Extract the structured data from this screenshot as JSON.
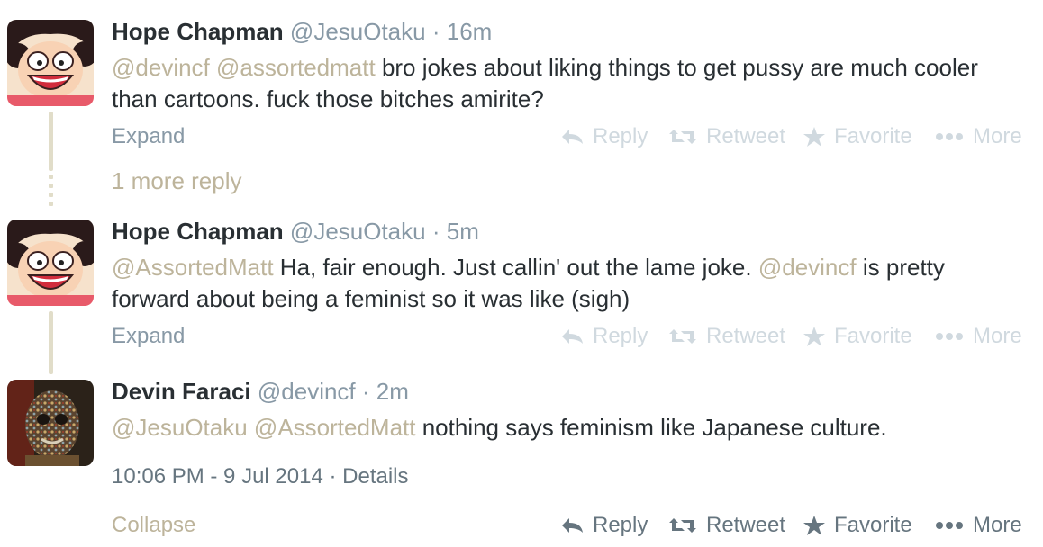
{
  "tweets": [
    {
      "name": "Hope Chapman",
      "handle": "@JesuOtaku",
      "sep": "·",
      "time": "16m",
      "mentions": [
        "@devincf",
        "@assortedmatt"
      ],
      "text": "bro jokes about liking things to get pussy are much cooler than cartoons. fuck those bitches amirite?",
      "expand_label": "Expand"
    },
    {
      "name": "Hope Chapman",
      "handle": "@JesuOtaku",
      "sep": "·",
      "time": "5m",
      "mention1": "@AssortedMatt",
      "text_part1": "Ha, fair enough. Just callin' out the lame joke.",
      "mention2": "@devincf",
      "text_part2": "is pretty forward about being a feminist so it was like (sigh)",
      "expand_label": "Expand"
    },
    {
      "name": "Devin Faraci",
      "handle": "@devincf",
      "sep": "·",
      "time": "2m",
      "mentions": [
        "@JesuOtaku",
        "@AssortedMatt"
      ],
      "text": "nothing says feminism like Japanese culture.",
      "collapse_label": "Collapse"
    }
  ],
  "more_replies": "1 more reply",
  "details": {
    "timestamp": "10:06 PM - 9 Jul 2014",
    "sep": "·",
    "link": "Details"
  },
  "actions": {
    "reply": "Reply",
    "retweet": "Retweet",
    "favorite": "Favorite",
    "more": "More"
  },
  "icons": {
    "reply": "reply-arrow-icon",
    "retweet": "retweet-arrows-icon",
    "favorite": "star-icon",
    "more": "ellipsis-icon"
  },
  "colors": {
    "mention": "#bdb49b",
    "muted": "#8899a6",
    "disabled_action": "#d0d9df",
    "active_action": "#66757f",
    "thread_line": "#e1ddc9"
  }
}
